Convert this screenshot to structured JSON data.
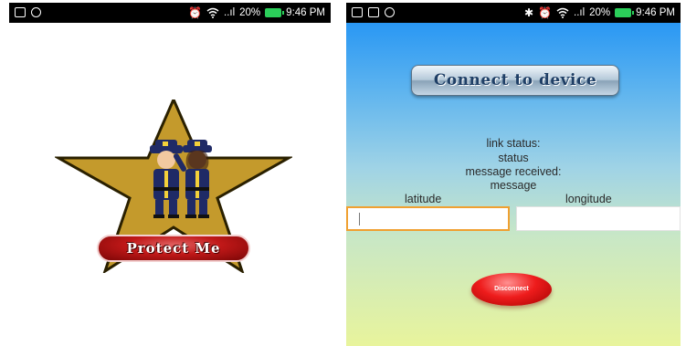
{
  "left_screen": {
    "status_bar": {
      "icons": [
        "notification-icon",
        "notification-icon",
        "alarm-icon",
        "wifi-icon",
        "signal-icon",
        "battery-icon"
      ],
      "signal_text": "..ıl",
      "battery": "20%",
      "time": "9:46 PM"
    },
    "app_name": "Protect Me",
    "colors": {
      "star": "#c49a2c",
      "badge": "#c01818",
      "uniform": "#1f2a66"
    }
  },
  "right_screen": {
    "status_bar": {
      "icons": [
        "notification-icon",
        "notification-icon",
        "notification-icon",
        "bluetooth-icon",
        "alarm-icon",
        "wifi-icon",
        "signal-icon",
        "battery-icon"
      ],
      "signal_text": "..ıl",
      "battery": "20%",
      "time": "9:46 PM"
    },
    "connect_button_label": "Connect to device",
    "link_status_label": "link status:",
    "status_value": "status",
    "message_received_label": "message received:",
    "message_value": "message",
    "latitude_label": "latitude",
    "longitude_label": "longitude",
    "latitude_value": "",
    "longitude_value": "",
    "disconnect_label": "Disconnect",
    "colors": {
      "background_top": "#1a8ff5",
      "background_bottom": "#e8f49c",
      "focused_field": "#f0a030",
      "disconnect": "#ee1c1c"
    }
  }
}
